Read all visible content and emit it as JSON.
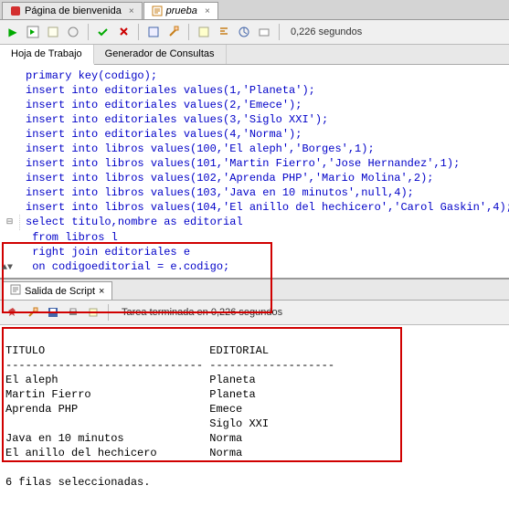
{
  "tabs": [
    {
      "label": "Página de bienvenida",
      "active": false
    },
    {
      "label": "prueba",
      "active": true
    }
  ],
  "toolbar_time": "0,226 segundos",
  "subtabs": {
    "worksheet": "Hoja de Trabajo",
    "query_builder": "Generador de Consultas"
  },
  "code": {
    "l1": "primary key(codigo);",
    "l2": "",
    "l3": "insert into editoriales values(1,'Planeta');",
    "l4": "insert into editoriales values(2,'Emece');",
    "l5": "insert into editoriales values(3,'Siglo XXI');",
    "l6": "insert into editoriales values(4,'Norma');",
    "l7": "",
    "l8": "insert into libros values(100,'El aleph','Borges',1);",
    "l9": "insert into libros values(101,'Martin Fierro','Jose Hernandez',1);",
    "l10": "insert into libros values(102,'Aprenda PHP','Mario Molina',2);",
    "l11": "insert into libros values(103,'Java en 10 minutos',null,4);",
    "l12": "insert into libros values(104,'El anillo del hechicero','Carol Gaskin',4);",
    "l13": "",
    "s1": "select titulo,nombre as editorial",
    "s2": " from libros l",
    "s3": " right join editoriales e",
    "s4": " on codigoeditorial = e.codigo;"
  },
  "out_tab": "Salida de Script",
  "out_status": "Tarea terminada en 0,226 segundos",
  "output": {
    "header_titulo": "TITULO",
    "header_editorial": "EDITORIAL",
    "divider1": "------------------------------",
    "divider2": "-------------------",
    "rows": [
      {
        "titulo": "El aleph",
        "editorial": "Planeta"
      },
      {
        "titulo": "Martin Fierro",
        "editorial": "Planeta"
      },
      {
        "titulo": "Aprenda PHP",
        "editorial": "Emece"
      },
      {
        "titulo": "",
        "editorial": "Siglo XXI"
      },
      {
        "titulo": "Java en 10 minutos",
        "editorial": "Norma"
      },
      {
        "titulo": "El anillo del hechicero",
        "editorial": "Norma"
      }
    ],
    "footer": "6 filas seleccionadas."
  },
  "icons": {
    "run": "▶",
    "pin": "📌",
    "eraser": "✎",
    "save": "💾",
    "print": "🖶"
  }
}
